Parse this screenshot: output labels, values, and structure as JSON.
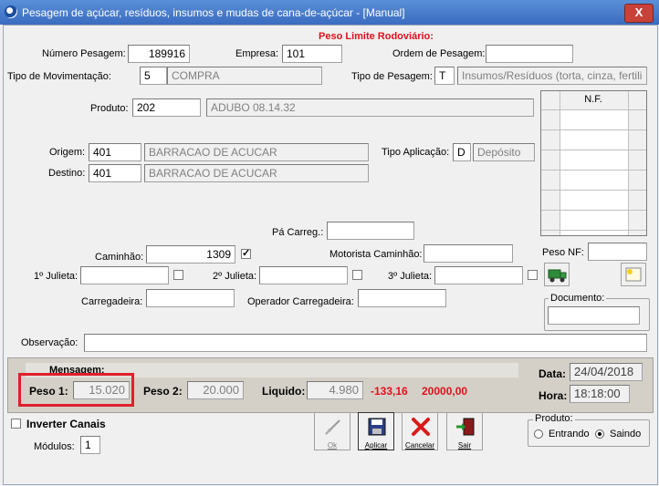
{
  "window": {
    "title": "Pesagem de açúcar, resíduos, insumos e mudas de cana-de-açúcar - [Manual]",
    "close": "X"
  },
  "header": {
    "peso_limite": "Peso Limite Rodoviário:"
  },
  "form": {
    "numero_pesagem_label": "Número Pesagem:",
    "numero_pesagem": "189916",
    "empresa_label": "Empresa:",
    "empresa": "101",
    "ordem_label": "Ordem de Pesagem:",
    "ordem": "",
    "tipo_mov_label": "Tipo de Movimentação:",
    "tipo_mov_code": "5",
    "tipo_mov_desc": "COMPRA",
    "tipo_pesagem_label": "Tipo de Pesagem:",
    "tipo_pesagem_code": "T",
    "tipo_pesagem_desc": "Insumos/Resíduos (torta, cinza, fertili",
    "produto_label": "Produto:",
    "produto_code": "202",
    "produto_desc": "ADUBO 08.14.32",
    "origem_label": "Origem:",
    "origem_code": "401",
    "origem_desc": "BARRACAO DE ACUCAR",
    "destino_label": "Destino:",
    "destino_code": "401",
    "destino_desc": "BARRACAO DE ACUCAR",
    "tipo_aplic_label": "Tipo Aplicação:",
    "tipo_aplic_code": "D",
    "tipo_aplic_desc": "Depósito",
    "pa_carreg_label": "Pá Carreg.:",
    "pa_carreg": "",
    "caminhao_label": "Caminhão:",
    "caminhao": "1309",
    "motorista_label": "Motorista Caminhão:",
    "motorista": "",
    "peso_nf_label": "Peso NF:",
    "peso_nf": "",
    "julieta1_label": "1º Julieta:",
    "julieta2_label": "2º Julieta:",
    "julieta3_label": "3º Julieta:",
    "carregadeira_label": "Carregadeira:",
    "op_carregadeira_label": "Operador Carregadeira:",
    "documento_label": "Documento:",
    "observacao_label": "Observação:"
  },
  "nf_grid": {
    "header": "N.F."
  },
  "weights": {
    "mensagem_label": "Mensagem:",
    "peso1_label": "Peso 1:",
    "peso1": "15.020",
    "peso2_label": "Peso 2:",
    "peso2": "20.000",
    "liquido_label": "Liquido:",
    "liquido": "4.980",
    "diff": "-133,16",
    "limite": "20000,00",
    "data_label": "Data:",
    "data": "24/04/2018",
    "hora_label": "Hora:",
    "hora": "18:18:00"
  },
  "options": {
    "inverter_label": "Inverter Canais",
    "modulos_label": "Módulos:",
    "modulos": "1"
  },
  "toolbar": {
    "ok": "Ok",
    "aplicar": "Aplicar",
    "cancelar": "Cancelar",
    "sair": "Sair"
  },
  "produto_group": {
    "legend": "Produto:",
    "entrando": "Entrando",
    "saindo": "Saindo"
  },
  "colors": {
    "accent_red": "#e0101c",
    "title_blue": "#3a6cc0"
  }
}
